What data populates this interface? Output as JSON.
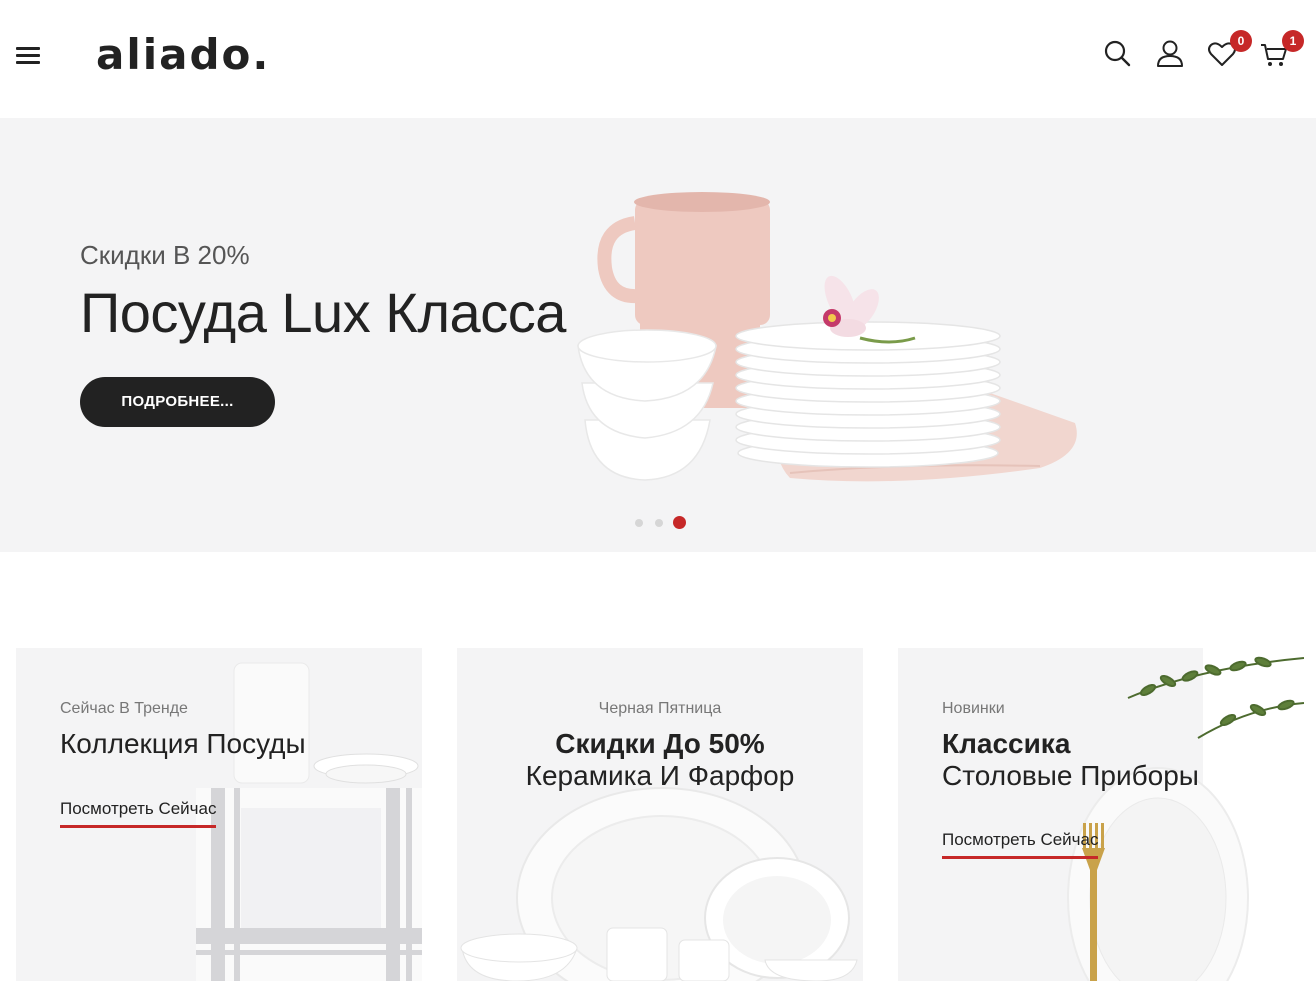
{
  "header": {
    "logo": "aliado.",
    "wishlist_count": "0",
    "cart_count": "1",
    "icons": [
      "menu-icon",
      "search-icon",
      "user-icon",
      "heart-icon",
      "cart-icon"
    ]
  },
  "hero": {
    "subtitle": "Скидки В 20%",
    "title": "Посуда Lux Класса",
    "button": "ПОДРОБНЕЕ...",
    "slides_total": 3,
    "active_slide": 3
  },
  "cards": [
    {
      "subtitle": "Сейчас В Тренде",
      "title": "Коллекция Посуды",
      "link": "Посмотреть Сейчас"
    },
    {
      "subtitle": "Черная Пятница",
      "title_bold": "Скидки До 50%",
      "title": "Керамика И Фарфор"
    },
    {
      "subtitle": "Новинки",
      "title_bold": "Классика",
      "title": "Столовые Приборы",
      "link": "Посмотреть Сейчас"
    }
  ],
  "colors": {
    "accent": "#c62828",
    "dark": "#222222",
    "hero_bg": "#f4f4f5"
  }
}
